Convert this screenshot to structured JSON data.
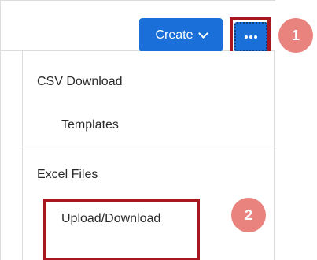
{
  "toolbar": {
    "create_label": "Create",
    "create_icon": "chevron-down-icon",
    "more_icon": "ellipsis-icon"
  },
  "menu": {
    "sections": [
      {
        "header": "CSV Download",
        "items": [
          "Templates"
        ]
      },
      {
        "header": "Excel Files",
        "items": [
          "Upload/Download"
        ]
      }
    ]
  },
  "annotations": {
    "step1": "1",
    "step2": "2"
  },
  "colors": {
    "button_blue": "#1a6fd9",
    "highlight_red": "#a8171f",
    "step_circle": "#e8837e"
  }
}
